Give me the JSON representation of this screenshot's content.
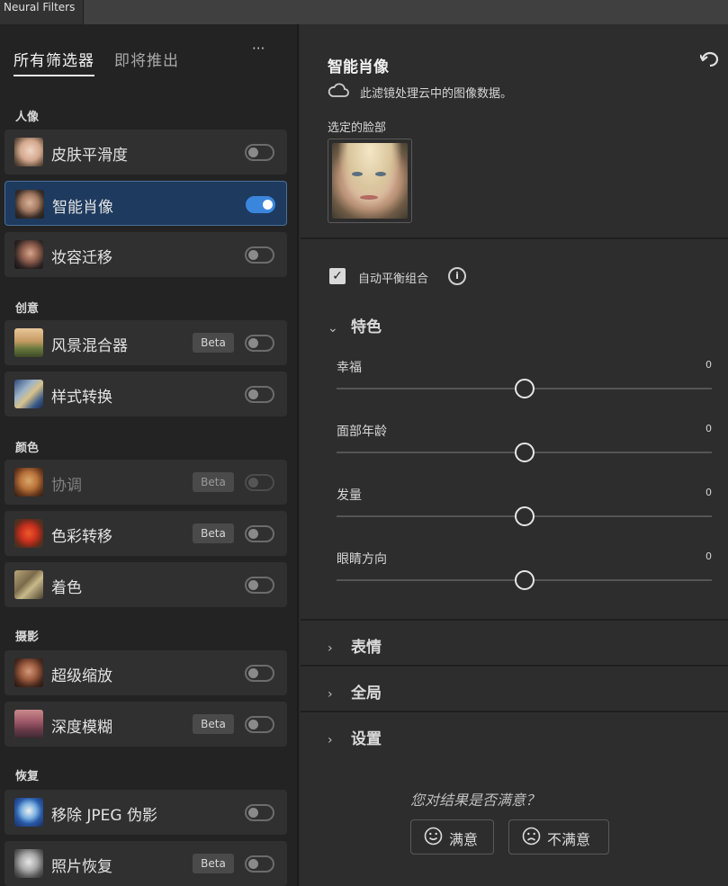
{
  "window": {
    "title": "Neural Filters"
  },
  "tabs": {
    "all": "所有筛选器",
    "coming": "即将推出",
    "more": "···"
  },
  "groups": [
    {
      "label": "人像",
      "filters": [
        {
          "label": "皮肤平滑度",
          "badge": "",
          "on": false
        },
        {
          "label": "智能肖像",
          "badge": "",
          "on": true,
          "selected": true
        },
        {
          "label": "妆容迁移",
          "badge": "",
          "on": false
        }
      ]
    },
    {
      "label": "创意",
      "filters": [
        {
          "label": "风景混合器",
          "badge": "Beta",
          "on": false
        },
        {
          "label": "样式转换",
          "badge": "",
          "on": false
        }
      ]
    },
    {
      "label": "颜色",
      "filters": [
        {
          "label": "协调",
          "badge": "Beta",
          "on": false,
          "disabled": true
        },
        {
          "label": "色彩转移",
          "badge": "Beta",
          "on": false
        },
        {
          "label": "着色",
          "badge": "",
          "on": false
        }
      ]
    },
    {
      "label": "摄影",
      "filters": [
        {
          "label": "超级缩放",
          "badge": "",
          "on": false
        },
        {
          "label": "深度模糊",
          "badge": "Beta",
          "on": false
        }
      ]
    },
    {
      "label": "恢复",
      "filters": [
        {
          "label": "移除 JPEG 伪影",
          "badge": "",
          "on": false
        },
        {
          "label": "照片恢复",
          "badge": "Beta",
          "on": false
        }
      ]
    }
  ],
  "panel": {
    "title": "智能肖像",
    "cloud_note": "此滤镜处理云中的图像数据。",
    "selected_face_label": "选定的脸部",
    "auto_balance": {
      "label": "自动平衡组合",
      "checked": true
    },
    "features_section": "特色",
    "sliders": [
      {
        "label": "幸福",
        "value": "0",
        "level": 0.5
      },
      {
        "label": "面部年龄",
        "value": "0",
        "level": 0.5
      },
      {
        "label": "发量",
        "value": "0",
        "level": 0.5
      },
      {
        "label": "眼睛方向",
        "value": "0",
        "level": 0.5
      }
    ],
    "sections": [
      "表情",
      "全局",
      "设置"
    ],
    "feedback": {
      "question": "您对结果是否满意？",
      "satisfied": "满意",
      "unsatisfied": "不满意"
    }
  },
  "colors": {
    "accent": "#3a86dd",
    "selected_row": "#1e3a5e"
  }
}
